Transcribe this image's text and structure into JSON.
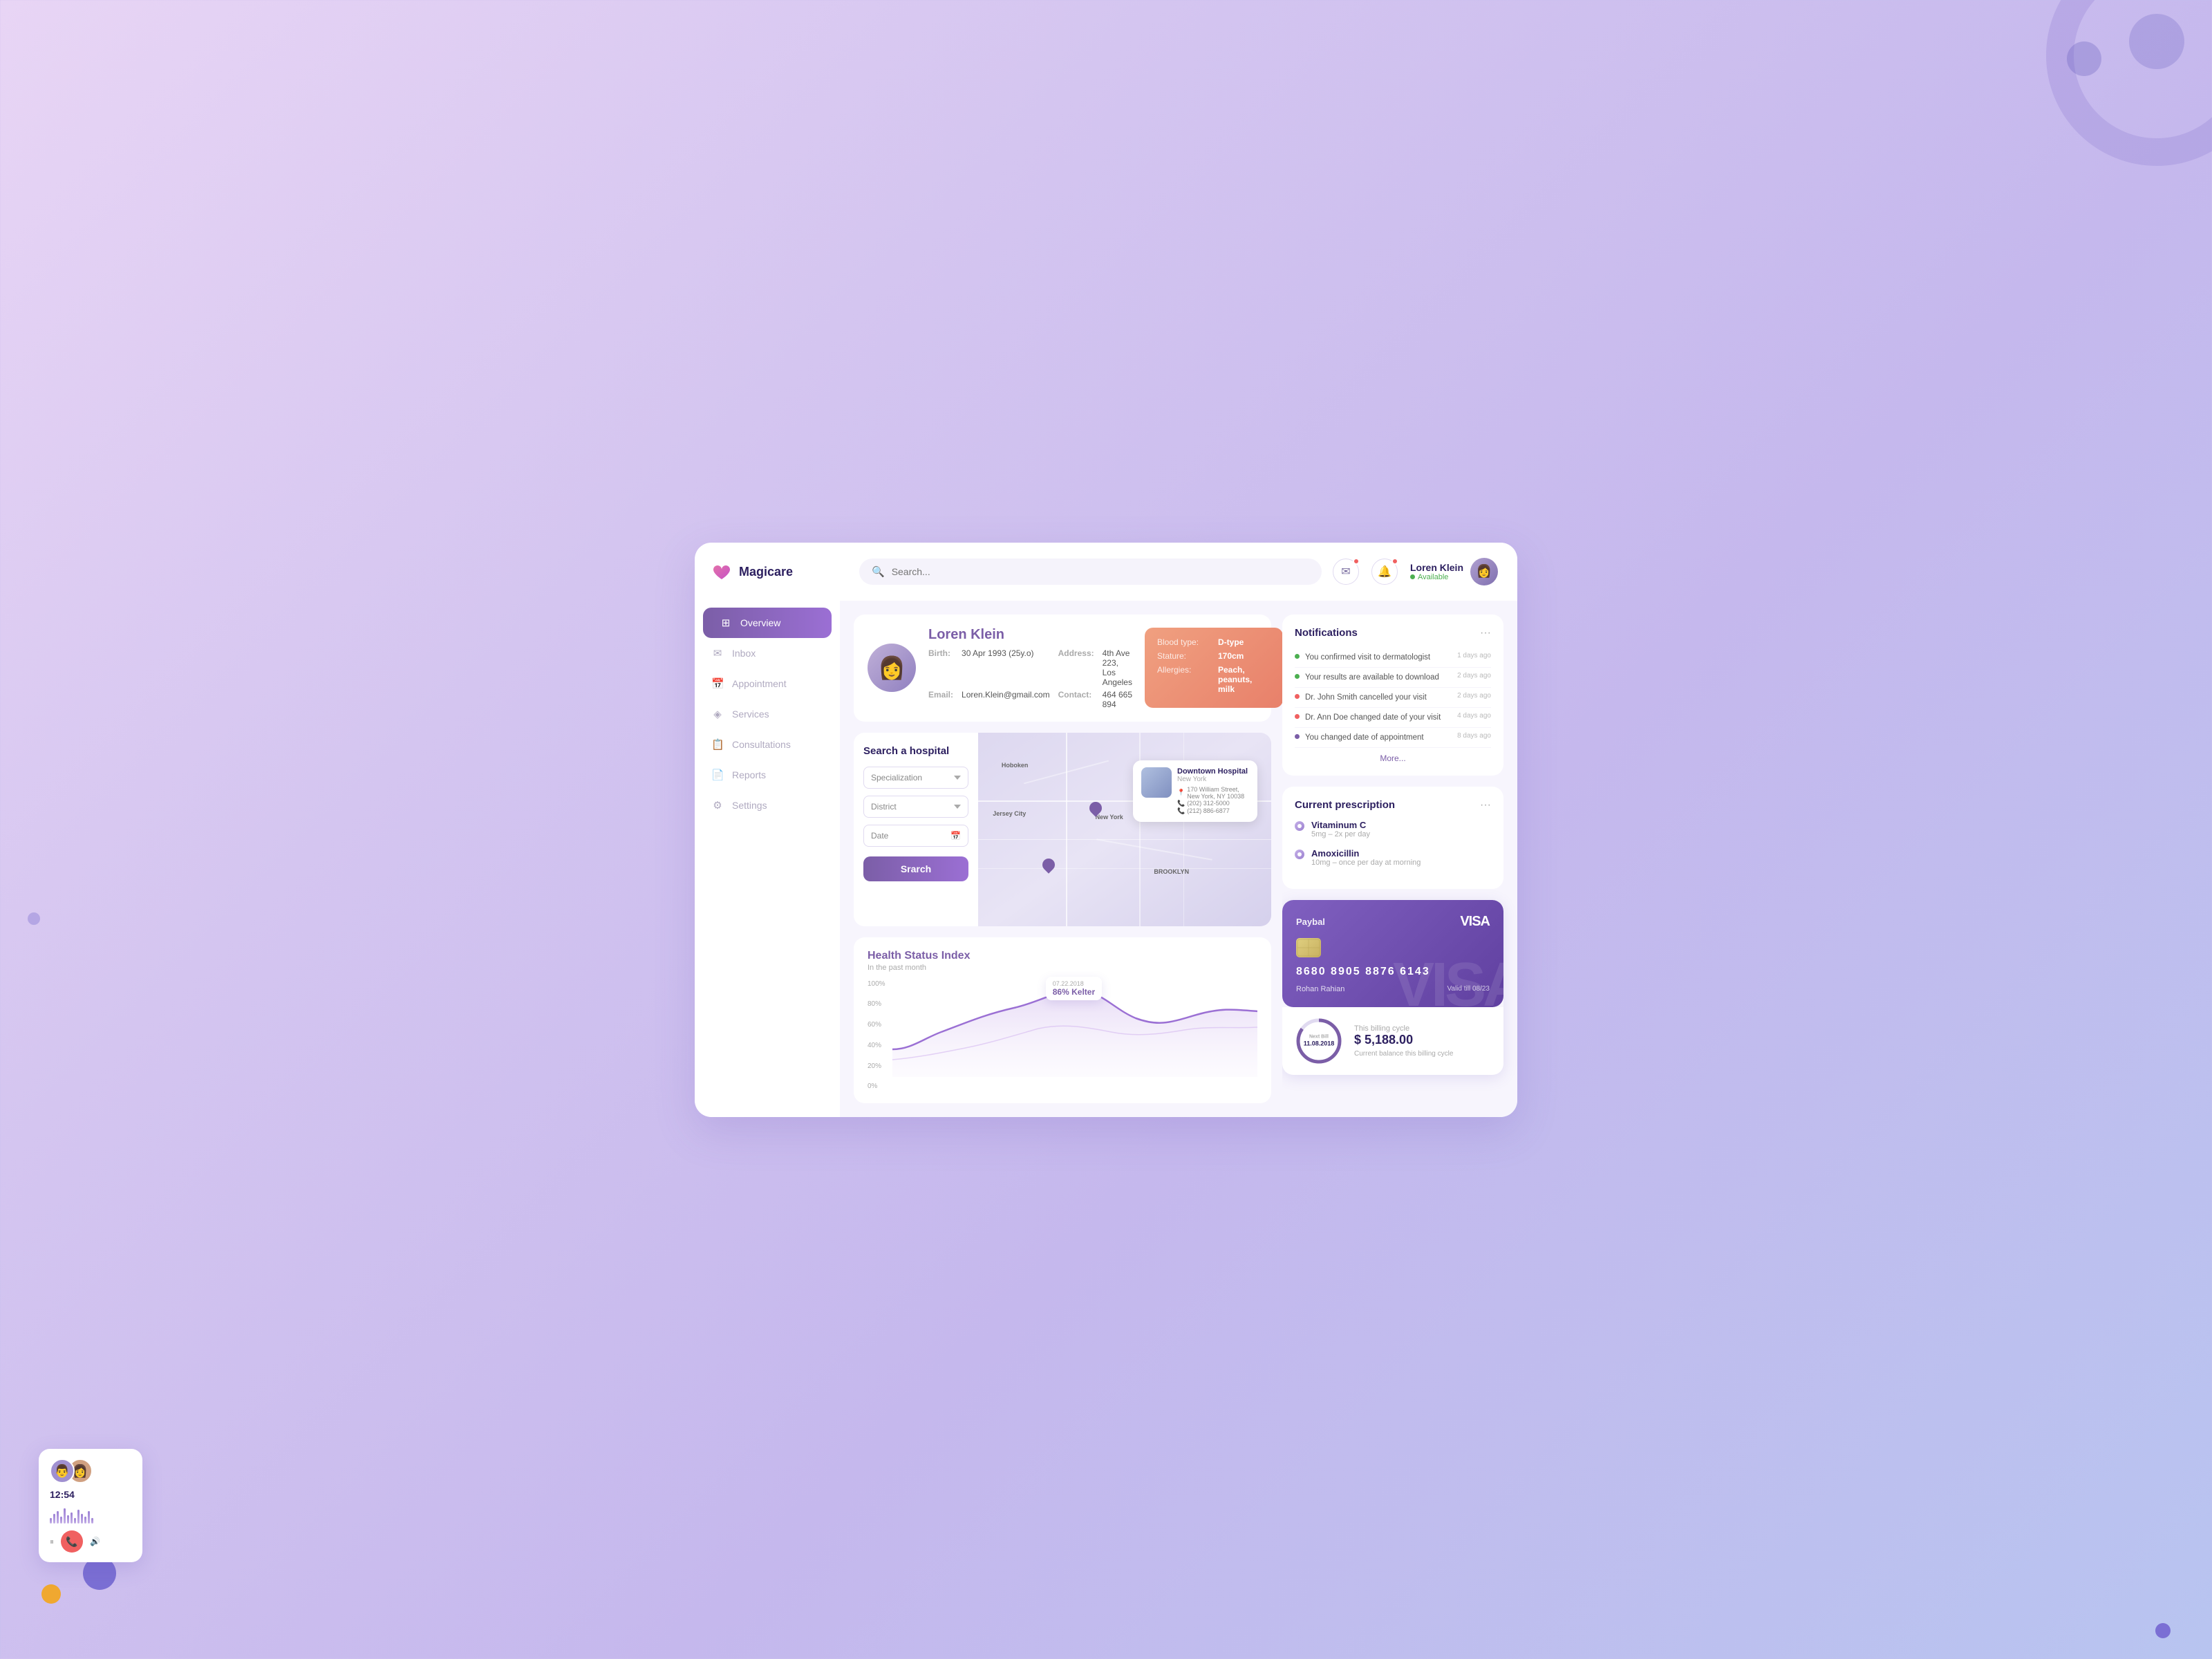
{
  "app": {
    "name": "Magicare"
  },
  "header": {
    "search_placeholder": "Search...",
    "user": {
      "name": "Loren Klein",
      "status": "Available"
    }
  },
  "sidebar": {
    "items": [
      {
        "id": "overview",
        "label": "Overview",
        "icon": "⊞",
        "active": true
      },
      {
        "id": "inbox",
        "label": "Inbox",
        "icon": "✉"
      },
      {
        "id": "appointment",
        "label": "Appointment",
        "icon": "📅"
      },
      {
        "id": "services",
        "label": "Services",
        "icon": "◈"
      },
      {
        "id": "consultations",
        "label": "Consultations",
        "icon": "📋"
      },
      {
        "id": "reports",
        "label": "Reports",
        "icon": "📄"
      },
      {
        "id": "settings",
        "label": "Settings",
        "icon": "⚙"
      }
    ]
  },
  "patient": {
    "name": "Loren Klein",
    "birth_label": "Birth:",
    "birth_value": "30 Apr 1993 (25y.o)",
    "address_label": "Address:",
    "address_value": "4th Ave 223, Los Angeles",
    "email_label": "Email:",
    "email_value": "Loren.Klein@gmail.com",
    "contact_label": "Contact:",
    "contact_value": "464 665 894",
    "stats": {
      "blood_type_label": "Blood type:",
      "blood_type_value": "D-type",
      "stature_label": "Stature:",
      "stature_value": "170cm",
      "allergies_label": "Allergies:",
      "allergies_value": "Peach, peanuts, milk"
    }
  },
  "hospital_search": {
    "title": "Search a hospital",
    "specialization_placeholder": "Specialization",
    "district_placeholder": "District",
    "date_placeholder": "Date",
    "search_button": "Srarch"
  },
  "hospital_popup": {
    "name": "Downtown Hospital",
    "city": "New York",
    "address": "170 William Street, New York, NY 10038",
    "phone1": "(202) 312-5000",
    "phone2": "(212) 886-6877"
  },
  "map": {
    "city_label": "New York"
  },
  "notifications": {
    "title": "Notifications",
    "items": [
      {
        "text": "You confirmed visit to dermatologist",
        "time": "1 days ago",
        "color": "#4caf50"
      },
      {
        "text": "Your results are available to download",
        "time": "2 days ago",
        "color": "#4caf50"
      },
      {
        "text": "Dr. John Smith cancelled your visit",
        "time": "2 days ago",
        "color": "#f06060"
      },
      {
        "text": "Dr. Ann Doe changed date of your visit",
        "time": "4 days ago",
        "color": "#f06060"
      },
      {
        "text": "You changed date of appointment",
        "time": "8 days ago",
        "color": "#7b5ea7"
      }
    ],
    "more_label": "More..."
  },
  "prescription": {
    "title": "Current prescription",
    "items": [
      {
        "name": "Vitaminum C",
        "dose": "5mg – 2x per day"
      },
      {
        "name": "Amoxicillin",
        "dose": "10mg – once per day at morning"
      }
    ]
  },
  "payment": {
    "brand": "Paybal",
    "network": "VISA",
    "number": "8680 8905 8876 6143",
    "holder": "Rohan Rahian",
    "valid": "Valid till 08/23"
  },
  "billing": {
    "next_bill_label": "Next Bill",
    "next_bill_date": "11.08.2018",
    "cycle_label": "This billing cycle",
    "amount": "$ 5,188.00",
    "balance_label": "Current balance this billing cycle"
  },
  "health_chart": {
    "title": "Health Status Index",
    "subtitle": "In the past month",
    "tooltip_date": "07.22.2018",
    "tooltip_value": "86% Kelter",
    "y_labels": [
      "100%",
      "80%",
      "60%",
      "40%",
      "20%",
      "0%"
    ]
  },
  "call_widget": {
    "time": "12:54"
  }
}
